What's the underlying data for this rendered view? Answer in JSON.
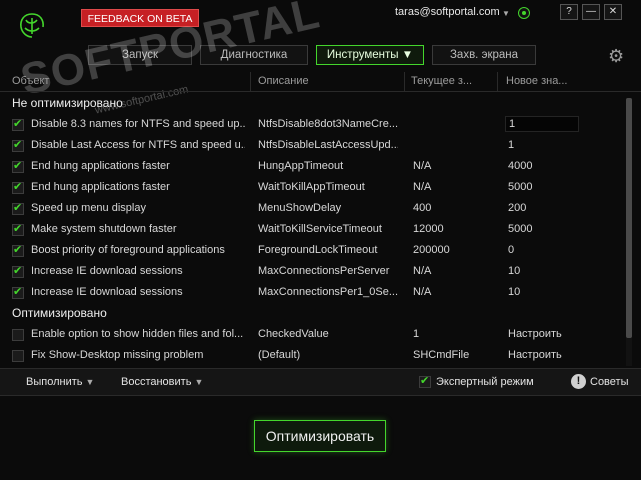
{
  "titlebar": {
    "feedback_label": "FEEDBACK ON BETA",
    "user": "taras@softportal.com",
    "help": "?",
    "minimize": "—",
    "close": "✕"
  },
  "watermark": {
    "brand": "SOFTPORTAL",
    "url": "www.softportal.com"
  },
  "tabs": [
    {
      "label": "Запуск"
    },
    {
      "label": "Диагностика"
    },
    {
      "label": "Инструменты ▼"
    },
    {
      "label": "Захв. экрана"
    }
  ],
  "columns": [
    "Объект",
    "Описание",
    "Текущее з...",
    "Новое зна..."
  ],
  "sections": {
    "not_optimized": "Не оптимизировано",
    "optimized": "Оптимизировано"
  },
  "rows_not_optimized": [
    {
      "checked": true,
      "name": "Disable 8.3 names for NTFS and speed up...",
      "desc": "NtfsDisable8dot3NameCre...",
      "current": "",
      "new": "1"
    },
    {
      "checked": true,
      "name": "Disable Last Access for NTFS and speed u...",
      "desc": "NtfsDisableLastAccessUpd...",
      "current": "",
      "new": "1"
    },
    {
      "checked": true,
      "name": "End hung applications faster",
      "desc": "HungAppTimeout",
      "current": "N/A",
      "new": "4000"
    },
    {
      "checked": true,
      "name": "End hung applications faster",
      "desc": "WaitToKillAppTimeout",
      "current": "N/A",
      "new": "5000"
    },
    {
      "checked": true,
      "name": "Speed up menu display",
      "desc": "MenuShowDelay",
      "current": "400",
      "new": "200"
    },
    {
      "checked": true,
      "name": "Make system shutdown faster",
      "desc": "WaitToKillServiceTimeout",
      "current": "12000",
      "new": "5000"
    },
    {
      "checked": true,
      "name": "Boost priority of foreground applications",
      "desc": "ForegroundLockTimeout",
      "current": "200000",
      "new": "0"
    },
    {
      "checked": true,
      "name": "Increase IE download sessions",
      "desc": "MaxConnectionsPerServer",
      "current": "N/A",
      "new": "10"
    },
    {
      "checked": true,
      "name": "Increase IE download sessions",
      "desc": "MaxConnectionsPer1_0Se...",
      "current": "N/A",
      "new": "10"
    }
  ],
  "rows_optimized": [
    {
      "checked": false,
      "name": "Enable option to show hidden files and fol...",
      "desc": "CheckedValue",
      "current": "1",
      "new": "Настроить"
    },
    {
      "checked": false,
      "name": "Fix Show-Desktop missing problem",
      "desc": "(Default)",
      "current": "SHCmdFile",
      "new": "Настроить"
    }
  ],
  "toolbar": {
    "run_label": "Выполнить",
    "restore_label": "Восстановить",
    "expert_label": "Экспертный режим",
    "expert_checked": true,
    "tips_label": "Советы"
  },
  "optimize_label": "Оптимизировать",
  "colors": {
    "accent": "#44d62c",
    "feedback": "#c62024",
    "background": "#0b0b0b"
  }
}
